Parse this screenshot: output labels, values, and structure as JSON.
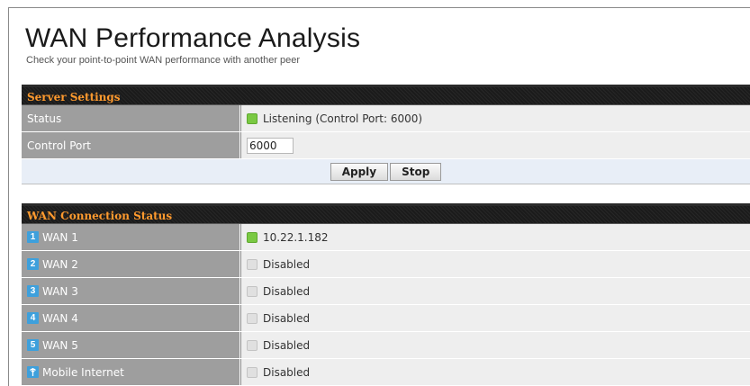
{
  "page": {
    "title": "WAN Performance Analysis",
    "subtitle": "Check your point-to-point WAN performance with another peer"
  },
  "server_settings": {
    "header": "Server Settings",
    "status_label": "Status",
    "status_value": "Listening (Control Port: 6000)",
    "status_color": "#7ac943",
    "control_port_label": "Control Port",
    "control_port_value": "6000",
    "apply_label": "Apply",
    "stop_label": "Stop"
  },
  "wan_status": {
    "header": "WAN Connection Status",
    "rows": [
      {
        "index": "1",
        "label": "WAN 1",
        "value": "10.22.1.182",
        "state": "active"
      },
      {
        "index": "2",
        "label": "WAN 2",
        "value": "Disabled",
        "state": "disabled"
      },
      {
        "index": "3",
        "label": "WAN 3",
        "value": "Disabled",
        "state": "disabled"
      },
      {
        "index": "4",
        "label": "WAN 4",
        "value": "Disabled",
        "state": "disabled"
      },
      {
        "index": "5",
        "label": "WAN 5",
        "value": "Disabled",
        "state": "disabled"
      },
      {
        "index": "mobile-icon",
        "label": "Mobile Internet",
        "value": "Disabled",
        "state": "disabled"
      }
    ]
  },
  "colors": {
    "header_text": "#ff9a2e",
    "label_bg": "#9e9e9e",
    "value_bg": "#eeeeee",
    "icon_blue": "#3ea0dc"
  }
}
